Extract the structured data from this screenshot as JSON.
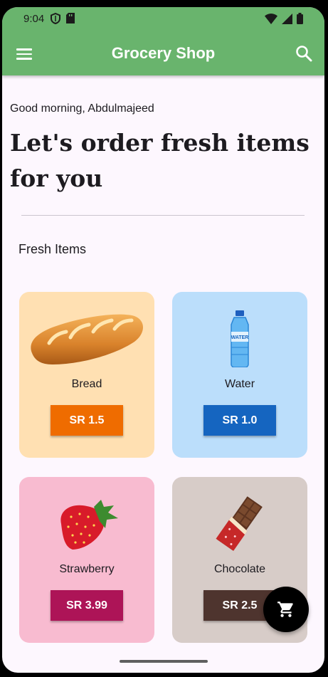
{
  "status_bar": {
    "time": "9:04"
  },
  "app_bar": {
    "title": "Grocery Shop"
  },
  "greeting": "Good morning, Abdulmajeed",
  "headline": "Let's order fresh items for you",
  "section_title": "Fresh Items",
  "items": [
    {
      "name": "Bread",
      "price": "SR 1.5",
      "card_color": "#ffe0b2",
      "button_color": "#ef6c00",
      "icon": "bread-icon"
    },
    {
      "name": "Water",
      "price": "SR 1.0",
      "card_color": "#bbdefb",
      "button_color": "#1565c0",
      "icon": "water-bottle-icon",
      "bottle_label": "WATER"
    },
    {
      "name": "Strawberry",
      "price": "SR 3.99",
      "card_color": "#f8bbd0",
      "button_color": "#ad1457",
      "icon": "strawberry-icon"
    },
    {
      "name": "Chocolate",
      "price": "SR 2.5",
      "card_color": "#d7ccc8",
      "button_color": "#4e342e",
      "icon": "chocolate-icon"
    }
  ],
  "theme": {
    "app_bar_color": "#69b46d",
    "background": "#fdf7fe"
  }
}
